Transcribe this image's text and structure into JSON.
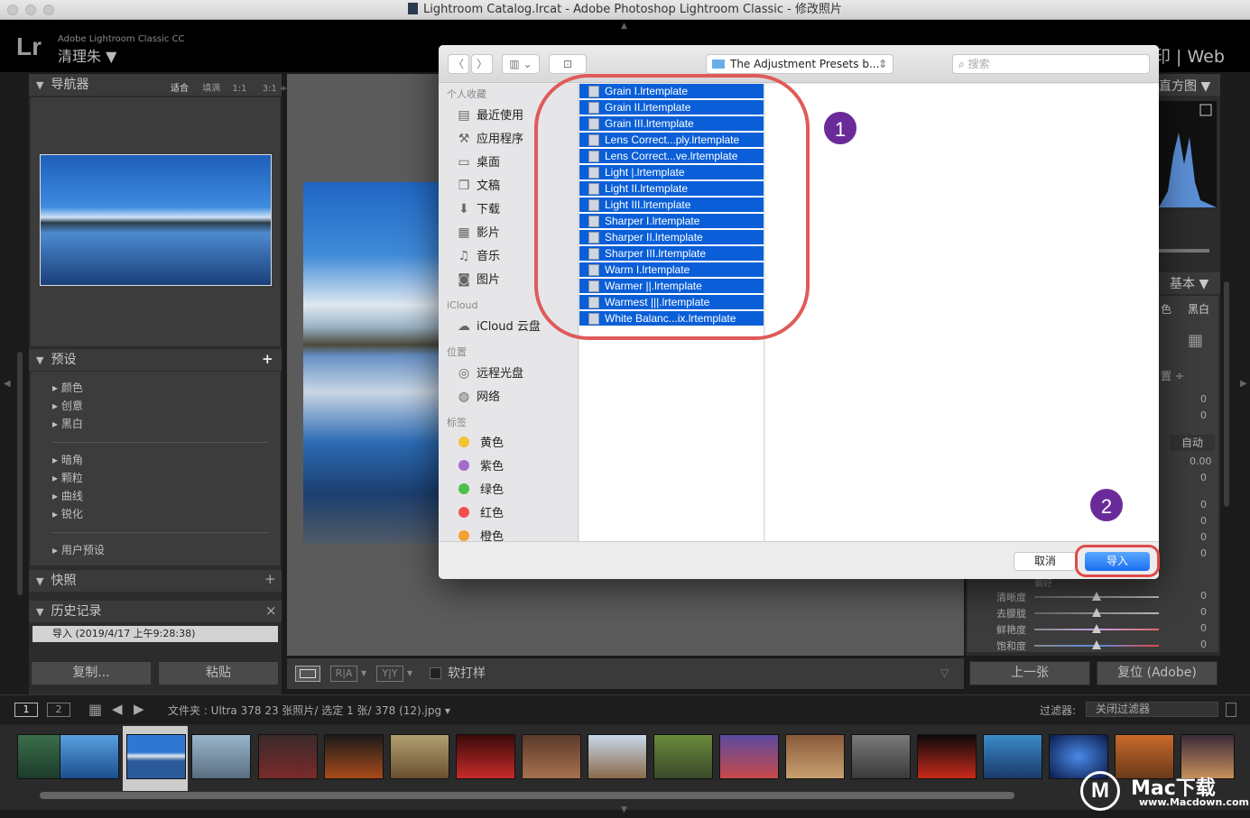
{
  "window": {
    "title": "Lightroom Catalog.lrcat - Adobe Photoshop Lightroom Classic - 修改照片"
  },
  "lr": {
    "logo": "Lr",
    "product": "Adobe Lightroom Classic CC",
    "user": "清理朱 ▼",
    "modules_right": "印 | Web"
  },
  "navigator": {
    "title": "导航器",
    "zoom_options": [
      "适合",
      "填满",
      "1:1",
      "3:1 ÷"
    ]
  },
  "presets": {
    "title": "预设",
    "add": "+",
    "groups_a": [
      "颜色",
      "创意",
      "黑白"
    ],
    "groups_b": [
      "暗角",
      "颗粒",
      "曲线",
      "锐化"
    ],
    "user": "用户预设"
  },
  "snapshots": {
    "title": "快照",
    "add": "+"
  },
  "history": {
    "title": "历史记录",
    "close": "×",
    "item": "导入 (2019/4/17 上午9:28:38)"
  },
  "left_buttons": {
    "copy": "复制...",
    "paste": "粘贴"
  },
  "toolbar": {
    "softproof": "软打样"
  },
  "right": {
    "histogram": "直方图 ▼",
    "basic": "基本 ▼",
    "bw": "黑白",
    "profile_fragment": "色",
    "wb_fragment": "置 ÷",
    "auto": "自动",
    "value_000": "0.00",
    "zeros": [
      "0",
      "0",
      "0",
      "0",
      "0",
      "0",
      "0"
    ],
    "section_pres": "偏好",
    "sliders": [
      {
        "label": "清晰度",
        "value": "0"
      },
      {
        "label": "去朦胧",
        "value": "0"
      },
      {
        "label": "鲜艳度",
        "value": "0"
      },
      {
        "label": "饱和度",
        "value": "0"
      }
    ],
    "prev": "上一张",
    "reset": "复位 (Adobe)"
  },
  "filmstrip": {
    "page1": "1",
    "page2": "2",
    "info": "文件夹 : Ultra 378   23 张照片/ 选定 1 张/ 378 (12).jpg ▾",
    "filter_label": "过滤器:",
    "filter_value": "关闭过滤器"
  },
  "dialog": {
    "folder": "The Adjustment Presets b...",
    "search_placeholder": "搜索",
    "favorites_header": "个人收藏",
    "favorites": [
      {
        "icon": "▤",
        "label": "最近使用"
      },
      {
        "icon": "⚒",
        "label": "应用程序"
      },
      {
        "icon": "▭",
        "label": "桌面"
      },
      {
        "icon": "❐",
        "label": "文稿"
      },
      {
        "icon": "⬇",
        "label": "下载"
      },
      {
        "icon": "▦",
        "label": "影片"
      },
      {
        "icon": "♫",
        "label": "音乐"
      },
      {
        "icon": "◙",
        "label": "图片"
      }
    ],
    "icloud_header": "iCloud",
    "icloud": [
      {
        "icon": "☁",
        "label": "iCloud 云盘"
      }
    ],
    "locations_header": "位置",
    "locations": [
      {
        "icon": "◎",
        "label": "远程光盘"
      },
      {
        "icon": "◍",
        "label": "网络"
      }
    ],
    "tags_header": "标签",
    "tags": [
      {
        "label": "黄色",
        "color": "#f5c231"
      },
      {
        "label": "紫色",
        "color": "#a56bd1"
      },
      {
        "label": "绿色",
        "color": "#4cc04a"
      },
      {
        "label": "红色",
        "color": "#f2504b"
      },
      {
        "label": "橙色",
        "color": "#f5a031"
      }
    ],
    "files": [
      "Grain I.lrtemplate",
      "Grain II.lrtemplate",
      "Grain III.lrtemplate",
      "Lens Correct...ply.lrtemplate",
      "Lens Correct...ve.lrtemplate",
      "Light |.lrtemplate",
      "Light II.lrtemplate",
      "Light III.lrtemplate",
      "Sharper I.lrtemplate",
      "Sharper II.lrtemplate",
      "Sharper III.lrtemplate",
      "Warm I.lrtemplate",
      "Warmer ||.lrtemplate",
      "Warmest |||.lrtemplate",
      "White Balanc...ix.lrtemplate"
    ],
    "cancel": "取消",
    "import": "导入"
  },
  "annotations": {
    "n1": "1",
    "n2": "2"
  },
  "watermark": {
    "brand": "Mac下载",
    "url": "www.Macdown.com"
  }
}
